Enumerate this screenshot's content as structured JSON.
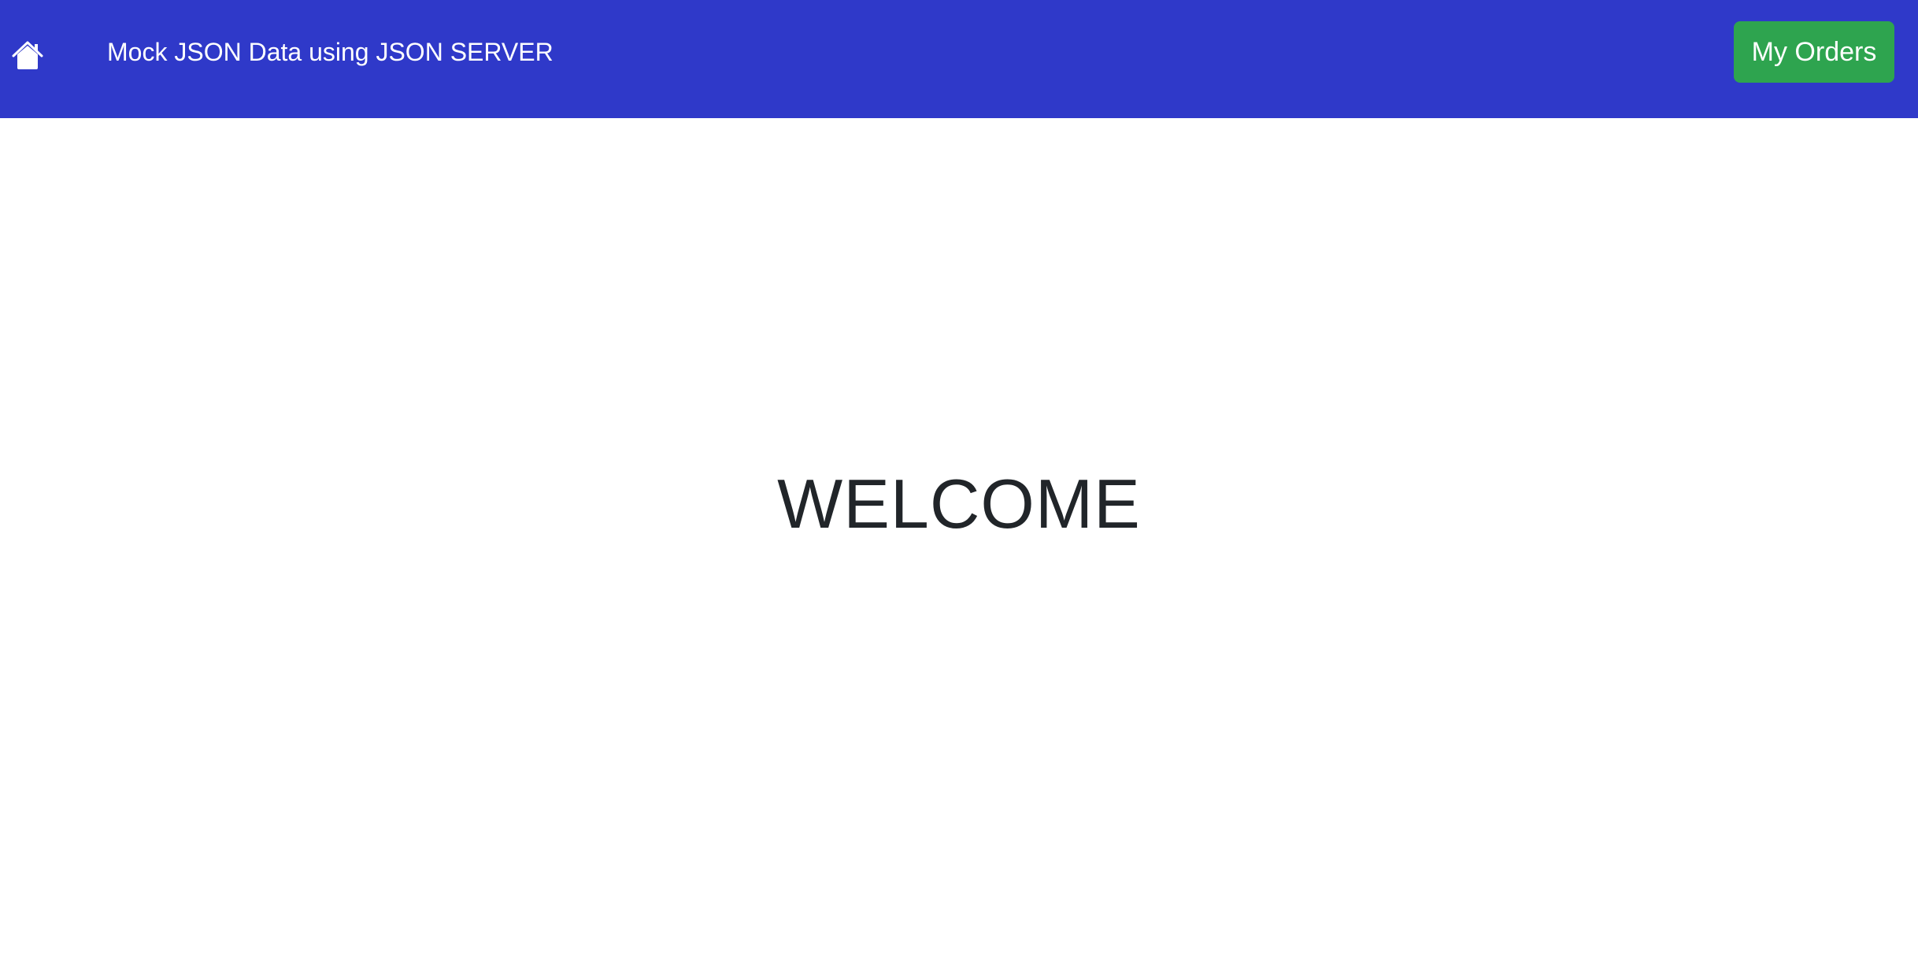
{
  "navbar": {
    "background_color": "#2f39c9",
    "home_icon": "home-icon",
    "brand": "Mock JSON Data using JSON SERVER",
    "orders_button": {
      "label": "My Orders",
      "color": "#2ea44f"
    }
  },
  "main": {
    "heading": "WELCOME",
    "text_color": "#212529"
  }
}
